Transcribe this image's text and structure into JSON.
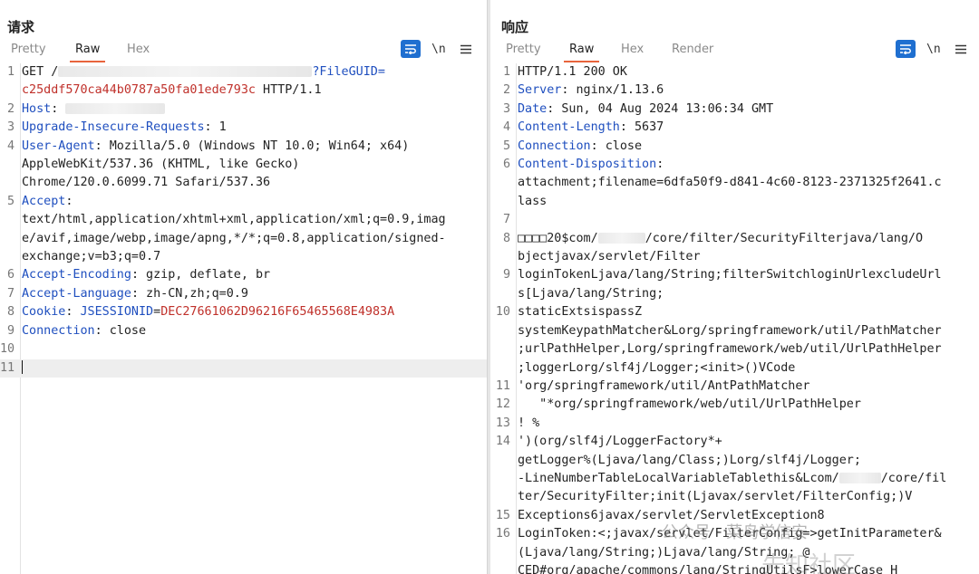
{
  "request": {
    "title": "请求",
    "tabs": [
      "Pretty",
      "Raw",
      "Hex"
    ],
    "active_tab": "Raw",
    "tool_newline": "\\n",
    "lines": [
      {
        "num": "1",
        "parts": [
          [
            "t",
            "GET /"
          ],
          [
            "blur",
            ""
          ],
          [
            "k",
            "?FileGUID="
          ]
        ]
      },
      {
        "num": "",
        "parts": [
          [
            "r",
            "c25ddf570ca44b0787a50fa01ede793c"
          ],
          [
            "t",
            " HTTP/1.1"
          ]
        ]
      },
      {
        "num": "2",
        "parts": [
          [
            "k",
            "Host"
          ],
          [
            "t",
            ": "
          ],
          [
            "blur",
            ""
          ]
        ]
      },
      {
        "num": "3",
        "parts": [
          [
            "k",
            "Upgrade-Insecure-Requests"
          ],
          [
            "t",
            ": 1"
          ]
        ]
      },
      {
        "num": "4",
        "parts": [
          [
            "k",
            "User-Agent"
          ],
          [
            "t",
            ": Mozilla/5.0 (Windows NT 10.0; Win64; x64)"
          ]
        ]
      },
      {
        "num": "",
        "parts": [
          [
            "t",
            "AppleWebKit/537.36 (KHTML, like Gecko)"
          ]
        ]
      },
      {
        "num": "",
        "parts": [
          [
            "t",
            "Chrome/120.0.6099.71 Safari/537.36"
          ]
        ]
      },
      {
        "num": "5",
        "parts": [
          [
            "k",
            "Accept"
          ],
          [
            "t",
            ":"
          ]
        ]
      },
      {
        "num": "",
        "parts": [
          [
            "t",
            "text/html,application/xhtml+xml,application/xml;q=0.9,imag"
          ]
        ]
      },
      {
        "num": "",
        "parts": [
          [
            "t",
            "e/avif,image/webp,image/apng,*/*;q=0.8,application/signed-"
          ]
        ]
      },
      {
        "num": "",
        "parts": [
          [
            "t",
            "exchange;v=b3;q=0.7"
          ]
        ]
      },
      {
        "num": "6",
        "parts": [
          [
            "k",
            "Accept-Encoding"
          ],
          [
            "t",
            ": gzip, deflate, br"
          ]
        ]
      },
      {
        "num": "7",
        "parts": [
          [
            "k",
            "Accept-Language"
          ],
          [
            "t",
            ": zh-CN,zh;q=0.9"
          ]
        ]
      },
      {
        "num": "8",
        "parts": [
          [
            "k",
            "Cookie"
          ],
          [
            "t",
            ": "
          ],
          [
            "k",
            "JSESSIONID"
          ],
          [
            "t",
            "="
          ],
          [
            "r",
            "DEC27661062D96216F65465568E4983A"
          ]
        ]
      },
      {
        "num": "9",
        "parts": [
          [
            "k",
            "Connection"
          ],
          [
            "t",
            ": close"
          ]
        ]
      },
      {
        "num": "10",
        "parts": []
      },
      {
        "num": "11",
        "parts": [],
        "cursor": true
      }
    ]
  },
  "response": {
    "title": "响应",
    "tabs": [
      "Pretty",
      "Raw",
      "Hex",
      "Render"
    ],
    "active_tab": "Raw",
    "tool_newline": "\\n",
    "lines": [
      {
        "num": "1",
        "parts": [
          [
            "t",
            "HTTP/1.1 200 OK"
          ]
        ]
      },
      {
        "num": "2",
        "parts": [
          [
            "k",
            "Server"
          ],
          [
            "t",
            ": nginx/1.13.6"
          ]
        ]
      },
      {
        "num": "3",
        "parts": [
          [
            "k",
            "Date"
          ],
          [
            "t",
            ": Sun, 04 Aug 2024 13:06:34 GMT"
          ]
        ]
      },
      {
        "num": "4",
        "parts": [
          [
            "k",
            "Content-Length"
          ],
          [
            "t",
            ": 5637"
          ]
        ]
      },
      {
        "num": "5",
        "parts": [
          [
            "k",
            "Connection"
          ],
          [
            "t",
            ": close"
          ]
        ]
      },
      {
        "num": "6",
        "parts": [
          [
            "k",
            "Content-Disposition"
          ],
          [
            "t",
            ":"
          ]
        ]
      },
      {
        "num": "",
        "parts": [
          [
            "t",
            "attachment;filename=6dfa50f9-d841-4c60-8123-2371325f2641.c"
          ]
        ]
      },
      {
        "num": "",
        "parts": [
          [
            "t",
            "lass"
          ]
        ]
      },
      {
        "num": "7",
        "parts": []
      },
      {
        "num": "8",
        "parts": [
          [
            "t",
            "□□□□20$com/"
          ],
          [
            "blur",
            ""
          ],
          [
            "t",
            "/core/filter/SecurityFilterjava/lang/O"
          ]
        ]
      },
      {
        "num": "",
        "parts": [
          [
            "t",
            "bjectjavax/servlet/Filter"
          ]
        ]
      },
      {
        "num": "9",
        "parts": [
          [
            "t",
            "loginTokenLjava/lang/String;filterSwitchloginUrlexcludeUrl"
          ]
        ]
      },
      {
        "num": "",
        "parts": [
          [
            "t",
            "s[Ljava/lang/String;"
          ]
        ]
      },
      {
        "num": "10",
        "parts": [
          [
            "t",
            "staticExtsispassZ"
          ]
        ]
      },
      {
        "num": "",
        "parts": [
          [
            "t",
            "systemKeypathMatcher&Lorg/springframework/util/PathMatcher"
          ]
        ]
      },
      {
        "num": "",
        "parts": [
          [
            "t",
            ";urlPathHelper,Lorg/springframework/web/util/UrlPathHelper"
          ]
        ]
      },
      {
        "num": "",
        "parts": [
          [
            "t",
            ";loggerLorg/slf4j/Logger;<init>()VCode"
          ]
        ]
      },
      {
        "num": "11",
        "parts": [
          [
            "t",
            "'org/springframework/util/AntPathMatcher"
          ]
        ]
      },
      {
        "num": "12",
        "parts": [
          [
            "t",
            "   \"*org/springframework/web/util/UrlPathHelper"
          ]
        ]
      },
      {
        "num": "13",
        "parts": [
          [
            "t",
            "! %"
          ]
        ]
      },
      {
        "num": "14",
        "parts": [
          [
            "t",
            "')(org/slf4j/LoggerFactory*+"
          ]
        ]
      },
      {
        "num": "",
        "parts": [
          [
            "t",
            "getLogger%(Ljava/lang/Class;)Lorg/slf4j/Logger;"
          ]
        ]
      },
      {
        "num": "",
        "parts": [
          [
            "t",
            "-LineNumberTableLocalVariableTablethis&Lcom/"
          ],
          [
            "blur",
            ""
          ],
          [
            "t",
            "/core/fil"
          ]
        ]
      },
      {
        "num": "",
        "parts": [
          [
            "t",
            "ter/SecurityFilter;init(Ljavax/servlet/FilterConfig;)V"
          ]
        ]
      },
      {
        "num": "15",
        "parts": [
          [
            "t",
            "Exceptions6javax/servlet/ServletException8"
          ]
        ]
      },
      {
        "num": "16",
        "parts": [
          [
            "t",
            "LoginToken:<;javax/servlet/FilterConfig=>getInitParameter&"
          ]
        ]
      },
      {
        "num": "",
        "parts": [
          [
            "t",
            "(Ljava/lang/String;)Ljava/lang/String; @"
          ]
        ]
      },
      {
        "num": "",
        "parts": [
          [
            "t",
            "CED#org/apache/commons/lang/StringUtilsF>lowerCase H"
          ]
        ]
      }
    ]
  },
  "watermark": {
    "line1": "公众号 · 菜鸟学信安",
    "line2": "先知社区"
  }
}
